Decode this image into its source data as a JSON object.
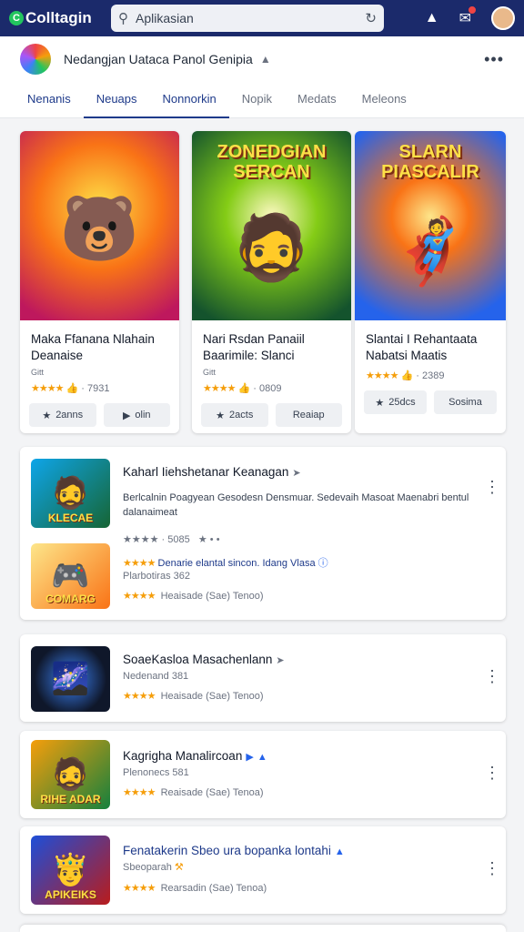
{
  "topbar": {
    "brand": "Colltagin",
    "brand_mark": "C",
    "search_value": "Aplikasian",
    "icons": [
      "search-icon",
      "refresh-icon",
      "store-icon",
      "mail-icon",
      "avatar"
    ]
  },
  "app": {
    "title": "Nedangjan Uataca Panol Genipia",
    "flag_icon": "▲",
    "more_label": "•••"
  },
  "tabs": [
    "Nenanis",
    "Neuaps",
    "Nonnorkin",
    "Nopik",
    "Medats",
    "Meleons"
  ],
  "featured": [
    {
      "title": "Maka Ffanana Nlahain Deanaise",
      "sub": "Gitt",
      "stars": "★★★★",
      "rating": "7931",
      "btn1": "2anns",
      "btn2": "olin",
      "logo": "",
      "hero": "🐻"
    },
    {
      "title": "Nari Rsdan Panaiil Baarimile: Slanci",
      "sub": "Gitt",
      "stars": "★★★★",
      "rating": "0809",
      "btn1": "2acts",
      "btn2": "Reaiap",
      "logo": "ZONEDGIAN SERCAN",
      "hero": "🧔"
    },
    {
      "title": "Slantai I Rehantaata Nabatsi Maatis",
      "sub": "",
      "stars": "★★★★",
      "rating": "2389",
      "btn1": "25dcs",
      "btn2": "Sosima",
      "logo": "SLARN PIASCALIR",
      "hero": "🦸"
    }
  ],
  "list": [
    {
      "title": "Kaharl Iiehshetanar Keanagan",
      "desc": "Berlcalnin Poagyean Gesodesn Densmuar. Sedevaih Masoat Maenabri bentul dalanaimeat",
      "meta_stars": "★★★★",
      "meta_rating": "5085",
      "meta_extra": "★ • •",
      "promo_title": "Denarie elantal sincon. Idang Vlasa",
      "promo_sub": "Plarbotiras 362",
      "stars": "★★★★",
      "rating_text": "Heaisade  (Sae)  Tenoo)",
      "thumb_caption": "KLECAE",
      "thumb2_caption": "COMARG"
    },
    {
      "title": "SoaeKasloa Masachenlann",
      "sub": "Nedenand 381",
      "stars": "★★★★",
      "rating_text": "Heaisade  (Sae)  Tenoo)",
      "thumb_caption": ""
    },
    {
      "title": "Kagrigha Manalircoan",
      "sub": "Plenonecs 581",
      "stars": "★★★★",
      "rating_text": "Reaisade  (Sae)  Tenoa)",
      "thumb_caption": "RIHE ADAR"
    },
    {
      "title": "Fenatakerin Sbeo ura bopanka lontahi",
      "sub": "Sbeoparah",
      "stars": "★★★★",
      "rating_text": "Rearsadin  (Sae)  Tenoa)",
      "thumb_caption": "APIKEIKS"
    }
  ]
}
